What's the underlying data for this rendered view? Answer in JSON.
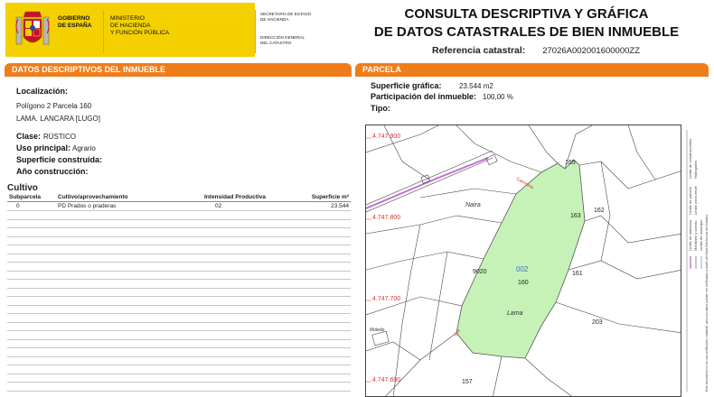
{
  "header": {
    "gobierno_lines": [
      "GOBIERNO",
      "DE ESPAÑA"
    ],
    "ministerio_lines": [
      "MINISTERIO",
      "DE HACIENDA",
      "Y FUNCIÓN PÚBLICA"
    ],
    "secretaria_lines": [
      "SECRETARÍA DE ESTADO",
      "DE HACIENDA"
    ],
    "direccion_lines": [
      "DIRECCIÓN GENERAL",
      "DEL CATASTRO"
    ],
    "title_line1": "CONSULTA DESCRIPTIVA Y GRÁFICA",
    "title_line2": "DE DATOS CATASTRALES DE BIEN INMUEBLE",
    "ref_label": "Referencia catastral:",
    "ref_value": "27026A002001600000ZZ",
    "brand_yellow": "#f4d000",
    "accent_orange": "#ef7d1a"
  },
  "left": {
    "section_title": "DATOS DESCRIPTIVOS DEL INMUEBLE",
    "localizacion_label": "Localización:",
    "localizacion_line1": "Polígono 2 Parcela 160",
    "localizacion_line2": "LAMA. LANCARA [LUGO]",
    "clase_label": "Clase:",
    "clase_value": "RÚSTICO",
    "uso_label": "Uso principal:",
    "uso_value": "Agrario",
    "superficie_label": "Superficie construida:",
    "anio_label": "Año construcción:",
    "cultivo_title": "Cultivo",
    "table_headers": {
      "subparcela": "Subparcela",
      "cultivo": "Cultivo/aprovechamiento",
      "intensidad": "Intensidad Productiva",
      "superficie": "Superficie m²"
    },
    "rows": [
      {
        "subparcela": "0",
        "cultivo": "PD Prados o praderas",
        "intensidad": "02",
        "superficie": "23.544"
      }
    ]
  },
  "right": {
    "section_title": "PARCELA",
    "sup_grafica_label": "Superficie gráfica:",
    "sup_grafica_value": "23.544 m2",
    "participacion_label": "Participación del inmueble:",
    "participacion_value": "100,00 %",
    "tipo_label": "Tipo:",
    "map": {
      "coord_labels": [
        "4.747.900",
        "4.747.800",
        "4.747.700",
        "4.747.600"
      ],
      "parcel_labels": [
        "165",
        "163",
        "162",
        "161",
        "160",
        "203",
        "157",
        "9020"
      ],
      "highlight_id": "002",
      "place_labels": [
        "Naira",
        "Lama",
        "Moledo"
      ],
      "road_labels": [
        "Carretera",
        "Cra"
      ],
      "highlight_color": "#c6f2b8"
    },
    "legend_items": [
      "Límite de manzana",
      "Límite de parcela",
      "Límite de construcciones",
      "Mobiliario y aceras",
      "Límite zona verde",
      "Hidrografía",
      "Límite de municipio"
    ],
    "legend_note": "Este documento no es una certificación catastral, pero sus datos pueden ser verificados a través del Sede Electrónica del Catastro"
  }
}
